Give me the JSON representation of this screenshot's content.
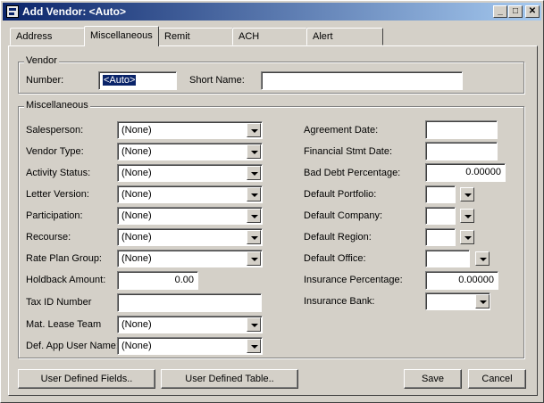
{
  "window": {
    "title": "Add Vendor: <Auto>"
  },
  "tabs": [
    {
      "label": "Address",
      "active": false
    },
    {
      "label": "Miscellaneous",
      "active": true
    },
    {
      "label": "Remit",
      "active": false
    },
    {
      "label": "ACH",
      "active": false
    },
    {
      "label": "Alert",
      "active": false
    }
  ],
  "vendor": {
    "group_label": "Vendor",
    "number_label": "Number:",
    "number_value": "<Auto>",
    "short_name_label": "Short Name:",
    "short_name_value": ""
  },
  "misc": {
    "group_label": "Miscellaneous",
    "salesperson_label": "Salesperson:",
    "salesperson_value": "(None)",
    "vendor_type_label": "Vendor Type:",
    "vendor_type_value": "(None)",
    "activity_status_label": "Activity Status:",
    "activity_status_value": "(None)",
    "letter_version_label": "Letter Version:",
    "letter_version_value": "(None)",
    "participation_label": "Participation:",
    "participation_value": "(None)",
    "recourse_label": "Recourse:",
    "recourse_value": "(None)",
    "rate_plan_group_label": "Rate Plan Group:",
    "rate_plan_group_value": "(None)",
    "holdback_amount_label": "Holdback Amount:",
    "holdback_amount_value": "0.00",
    "tax_id_label": "Tax ID Number",
    "tax_id_value": "",
    "mat_lease_team_label": "Mat. Lease Team",
    "mat_lease_team_value": "(None)",
    "def_app_user_label": "Def. App User Name:",
    "def_app_user_value": "(None)",
    "agreement_date_label": "Agreement Date:",
    "agreement_date_value": "",
    "financial_stmt_date_label": "Financial Stmt Date:",
    "financial_stmt_date_value": "",
    "bad_debt_label": "Bad Debt Percentage:",
    "bad_debt_value": "0.00000",
    "default_portfolio_label": "Default Portfolio:",
    "default_portfolio_value": "",
    "default_company_label": "Default Company:",
    "default_company_value": "",
    "default_region_label": "Default Region:",
    "default_region_value": "",
    "default_office_label": "Default Office:",
    "default_office_value": "",
    "insurance_pct_label": "Insurance Percentage:",
    "insurance_pct_value": "0.00000",
    "insurance_bank_label": "Insurance Bank:",
    "insurance_bank_value": ""
  },
  "buttons": {
    "user_defined_fields": "User Defined Fields..",
    "user_defined_table": "User Defined Table..",
    "save": "Save",
    "cancel": "Cancel"
  }
}
